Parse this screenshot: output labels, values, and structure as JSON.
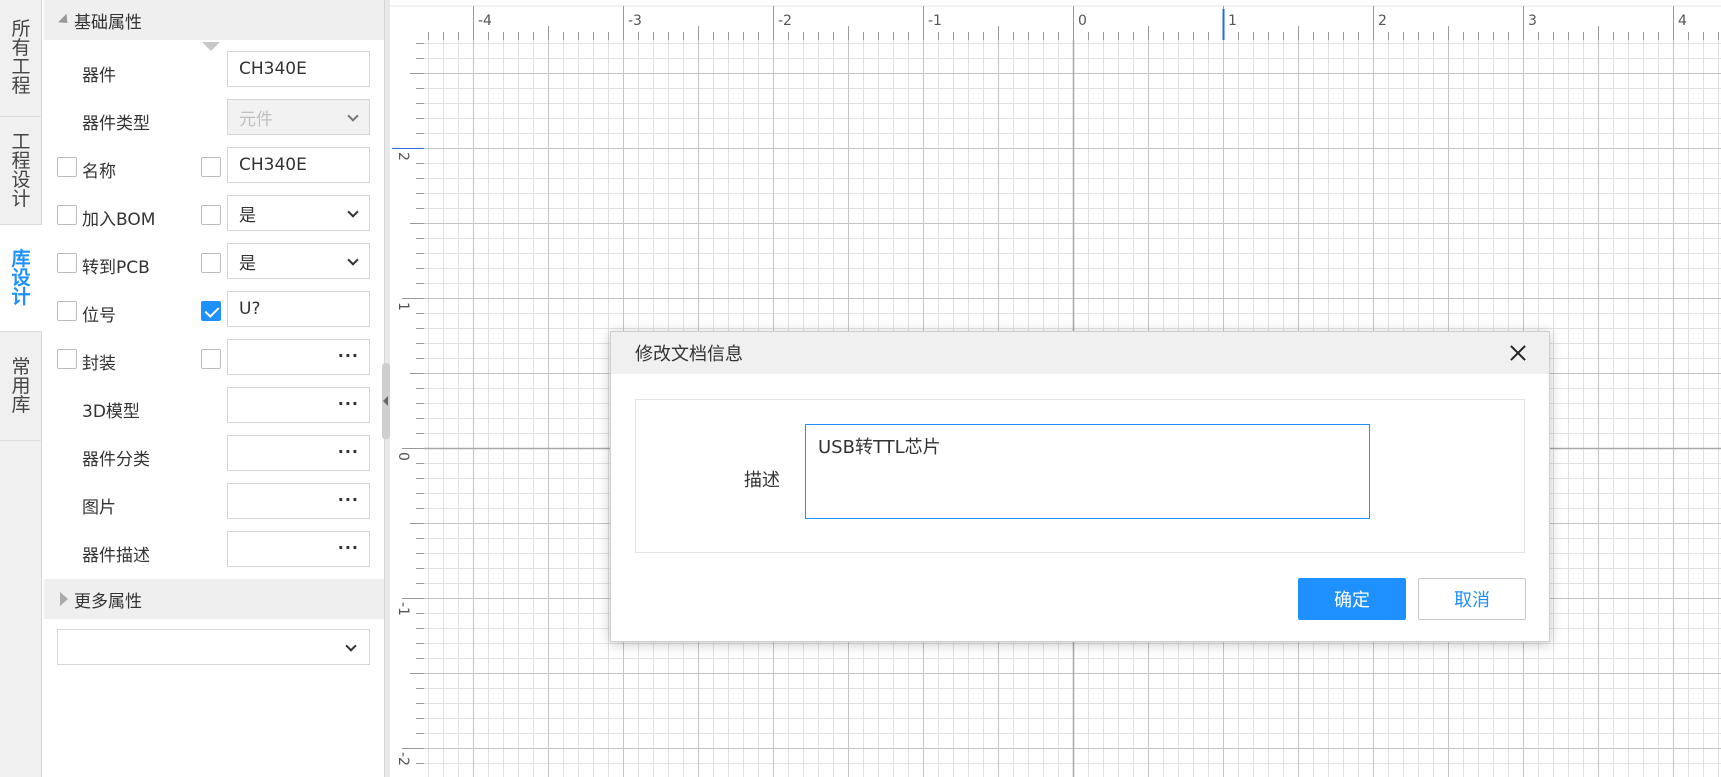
{
  "vertical_tabs": [
    {
      "label": "所有工程",
      "active": false
    },
    {
      "label": "工程设计",
      "active": false
    },
    {
      "label": "库设计",
      "active": true
    },
    {
      "label": "常用库",
      "active": false
    }
  ],
  "panel": {
    "basic_section": "基础属性",
    "more_section": "更多属性",
    "rows": [
      {
        "label": "器件",
        "left_cb": null,
        "right_cb": null,
        "field": "CH340E",
        "kind": "text"
      },
      {
        "label": "器件类型",
        "left_cb": null,
        "right_cb": null,
        "field": "元件",
        "kind": "select-disabled"
      },
      {
        "label": "名称",
        "left_cb": false,
        "right_cb": false,
        "field": "CH340E",
        "kind": "text"
      },
      {
        "label": "加入BOM",
        "left_cb": false,
        "right_cb": false,
        "field": "是",
        "kind": "select"
      },
      {
        "label": "转到PCB",
        "left_cb": false,
        "right_cb": false,
        "field": "是",
        "kind": "select"
      },
      {
        "label": "位号",
        "left_cb": false,
        "right_cb": true,
        "field": "U?",
        "kind": "text"
      },
      {
        "label": "封装",
        "left_cb": false,
        "right_cb": false,
        "field": "",
        "kind": "browse"
      },
      {
        "label": "3D模型",
        "left_cb": null,
        "right_cb": null,
        "field": "",
        "kind": "browse"
      },
      {
        "label": "器件分类",
        "left_cb": null,
        "right_cb": null,
        "field": "",
        "kind": "browse"
      },
      {
        "label": "图片",
        "left_cb": null,
        "right_cb": null,
        "field": "",
        "kind": "browse"
      },
      {
        "label": "器件描述",
        "left_cb": null,
        "right_cb": null,
        "field": "",
        "kind": "browse"
      }
    ],
    "bottom_select_value": "",
    "browse_glyph": "···"
  },
  "ruler": {
    "horizontal_labels": [
      "-4",
      "-3",
      "-2",
      "-1",
      "0",
      "1",
      "2",
      "3",
      "4"
    ],
    "vertical_labels": [
      "2",
      "1",
      "0",
      "-1",
      "-2"
    ]
  },
  "dialog": {
    "title": "修改文档信息",
    "desc_label": "描述",
    "desc_value": "USB转TTL芯片",
    "ok_label": "确定",
    "cancel_label": "取消"
  },
  "colors": {
    "accent": "#1e90ff",
    "grid_minor": "#e2e2e2",
    "grid_major": "#c4c4c4",
    "axis": "#a8a8a8"
  }
}
